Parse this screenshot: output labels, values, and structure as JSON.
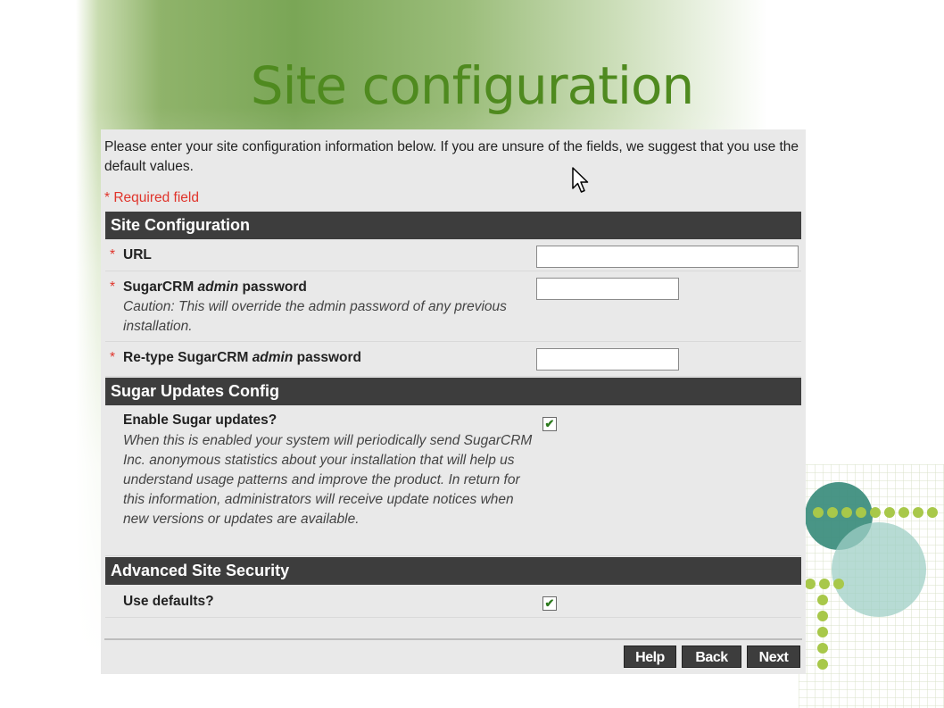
{
  "slide": {
    "title": "Site configuration"
  },
  "page": {
    "intro": "Please enter your site configuration information below. If you are unsure of the fields, we suggest that you use the default values.",
    "required_note": "* Required field"
  },
  "sections": {
    "site": {
      "title": "Site Configuration",
      "url": {
        "label": "URL",
        "value": ""
      },
      "admin_password": {
        "label_pre": "SugarCRM ",
        "label_em": "admin",
        "label_post": " password",
        "caution": "Caution: This will override the admin password of any previous installation.",
        "value": ""
      },
      "retype_password": {
        "label_pre": "Re-type SugarCRM ",
        "label_em": "admin",
        "label_post": " password",
        "value": ""
      }
    },
    "updates": {
      "title": "Sugar Updates Config",
      "enable_label": "Enable Sugar updates?",
      "enable_note": "When this is enabled your system will periodically send SugarCRM Inc. anonymous statistics about your installation that will help us understand usage patterns and improve the product. In return for this information, administrators will receive update notices when new versions or updates are available.",
      "enabled": true
    },
    "security": {
      "title": "Advanced Site Security",
      "defaults_label": "Use defaults?",
      "defaults": true
    }
  },
  "required_marker": "*",
  "check_mark": "✔",
  "buttons": {
    "help": "Help",
    "back": "Back",
    "next": "Next"
  },
  "colors": {
    "title_green": "#4f8a1f",
    "band": "#3d3d3d",
    "required_red": "#e0342b",
    "check_green": "#2d7a1e"
  }
}
